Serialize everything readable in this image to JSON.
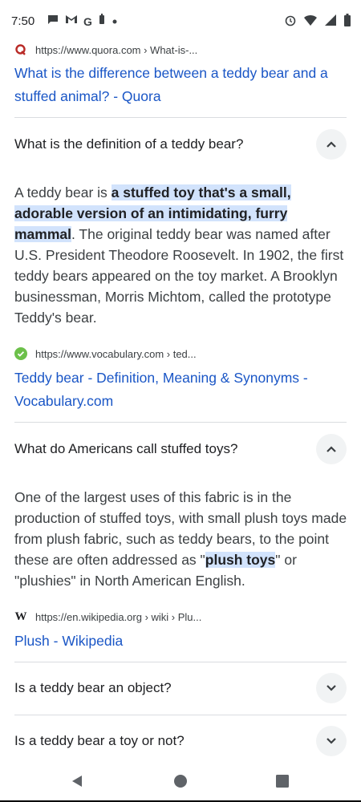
{
  "status_bar": {
    "time": "7:50",
    "left_icons": [
      "chat-icon",
      "gmail-icon",
      "google-icon",
      "battery-saver-icon",
      "dot-icon"
    ],
    "right_icons": [
      "alarm-icon",
      "wifi-icon",
      "signal-icon",
      "battery-icon"
    ]
  },
  "results": [
    {
      "source_url": "https://www.quora.com › What-is-...",
      "favicon": "quora-icon",
      "title": "What is the difference between a teddy bear and a stuffed animal? - Quora"
    }
  ],
  "questions": [
    {
      "question": "What is the definition of a teddy bear?",
      "expanded": true,
      "answer_before": "A teddy bear is ",
      "answer_highlight": "a stuffed toy that's a small, adorable version of an intimidating, furry mammal",
      "answer_after": ". The original teddy bear was named after U.S. President Theodore Roosevelt. In 1902, the first teddy bears appeared on the toy market. A Brooklyn businessman, Morris Michtom, called the prototype Teddy's bear.",
      "source_url": "https://www.vocabulary.com › ted...",
      "favicon": "vocabulary-check-icon",
      "source_title": "Teddy bear - Definition, Meaning & Synonyms - Vocabulary.com"
    },
    {
      "question": "What do Americans call stuffed toys?",
      "expanded": true,
      "answer_before": "One of the largest uses of this fabric is in the production of stuffed toys, with small plush toys made from plush fabric, such as teddy bears, to the point these are often addressed as \"",
      "answer_highlight": "plush toys",
      "answer_after": "\" or \"plushies\" in North American English.",
      "source_url": "https://en.wikipedia.org › wiki › Plu...",
      "favicon": "wikipedia-icon",
      "source_title": "Plush - Wikipedia"
    },
    {
      "question": "Is a teddy bear an object?",
      "expanded": false
    },
    {
      "question": "Is a teddy bear a toy or not?",
      "expanded": false
    }
  ],
  "colors": {
    "link": "#1a56c6",
    "highlight": "#d2e3fc",
    "divider": "#dadce0",
    "chevron_bg": "#f1f3f4"
  },
  "nav": [
    "back-icon",
    "home-icon",
    "recents-icon"
  ]
}
